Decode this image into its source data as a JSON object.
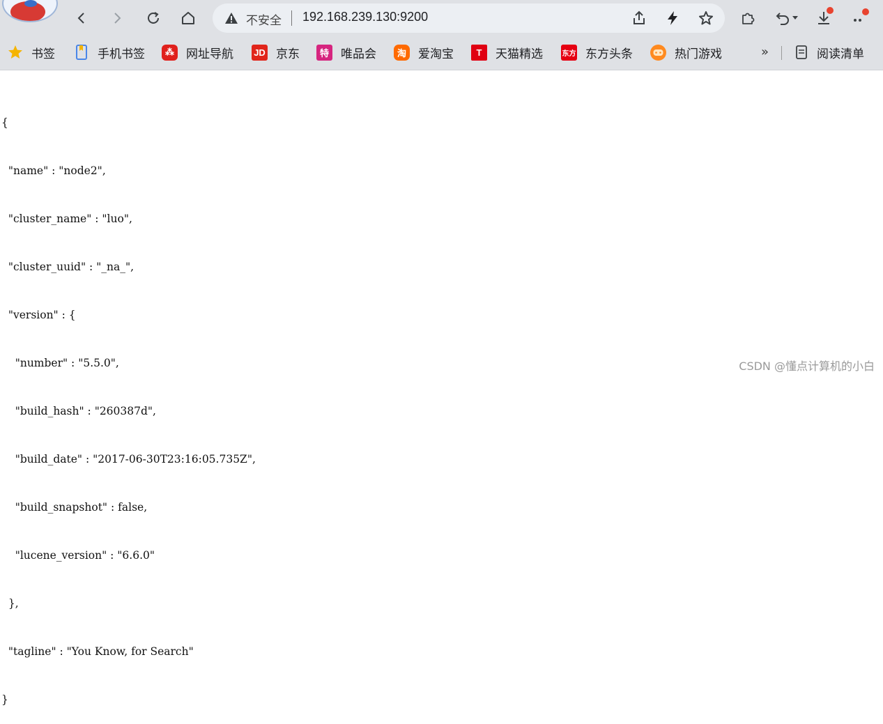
{
  "address_bar": {
    "security_label": "不安全",
    "url": "192.168.239.130:9200"
  },
  "bookmarks": [
    {
      "label": "书签",
      "icon": "star-icon"
    },
    {
      "label": "手机书签",
      "icon": "phone-bookmark-icon"
    },
    {
      "label": "网址导航",
      "icon": "nav-site-icon"
    },
    {
      "label": "京东",
      "icon": "jd-icon",
      "badge": "JD"
    },
    {
      "label": "唯品会",
      "icon": "vip-icon",
      "badge": "特"
    },
    {
      "label": "爱淘宝",
      "icon": "taobao-icon",
      "badge": "淘"
    },
    {
      "label": "天猫精选",
      "icon": "tmall-icon",
      "badge": "T"
    },
    {
      "label": "东方头条",
      "icon": "eastday-icon",
      "badge": "东方"
    },
    {
      "label": "热门游戏",
      "icon": "game-icon"
    }
  ],
  "more_bookmarks": "»",
  "reading_list": "阅读清单",
  "json_lines": [
    "{",
    "  \"name\" : \"node2\",",
    "  \"cluster_name\" : \"luo\",",
    "  \"cluster_uuid\" : \"_na_\",",
    "  \"version\" : {",
    "    \"number\" : \"5.5.0\",",
    "    \"build_hash\" : \"260387d\",",
    "    \"build_date\" : \"2017-06-30T23:16:05.735Z\",",
    "    \"build_snapshot\" : false,",
    "    \"lucene_version\" : \"6.6.0\"",
    "  },",
    "  \"tagline\" : \"You Know, for Search\"",
    "}"
  ],
  "watermark": "CSDN @懂点计算机的小白",
  "colors": {
    "chrome_bg": "#dfe1e5",
    "omnibox_bg": "#eceff3",
    "notification_dot": "#e8432f"
  }
}
